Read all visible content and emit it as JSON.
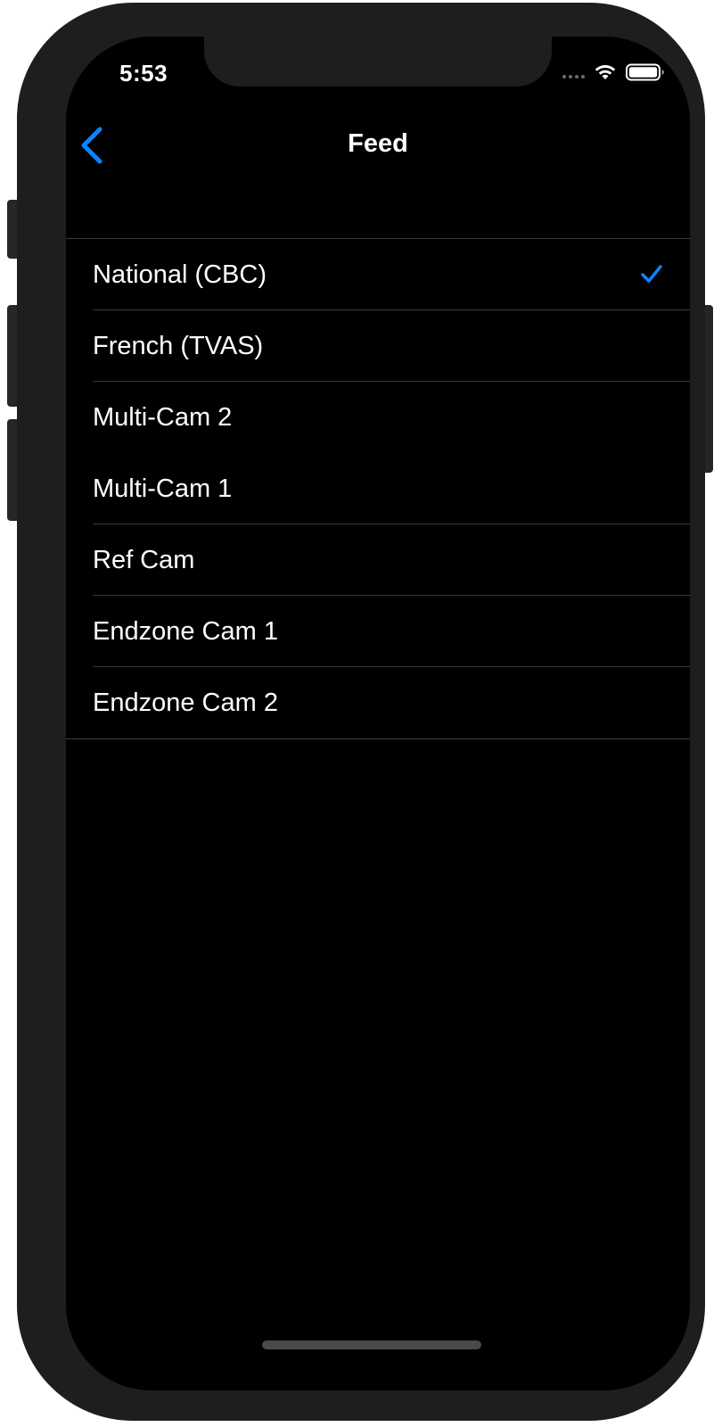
{
  "colors": {
    "accent": "#0a84ff",
    "background": "#000000",
    "text": "#ffffff",
    "separator": "#3a3a3c"
  },
  "status_bar": {
    "time": "5:53",
    "icons": [
      "cellular-dots-icon",
      "wifi-icon",
      "battery-icon"
    ]
  },
  "nav": {
    "back_icon": "chevron-left-icon",
    "title": "Feed"
  },
  "feeds": {
    "selected_index": 0,
    "items": [
      {
        "label": "National (CBC)",
        "selected": true
      },
      {
        "label": "French (TVAS)",
        "selected": false
      },
      {
        "label": "Multi-Cam 2",
        "selected": false
      },
      {
        "label": "Multi-Cam 1",
        "selected": false
      },
      {
        "label": "Ref Cam",
        "selected": false
      },
      {
        "label": "Endzone Cam 1",
        "selected": false
      },
      {
        "label": "Endzone Cam 2",
        "selected": false
      }
    ]
  }
}
